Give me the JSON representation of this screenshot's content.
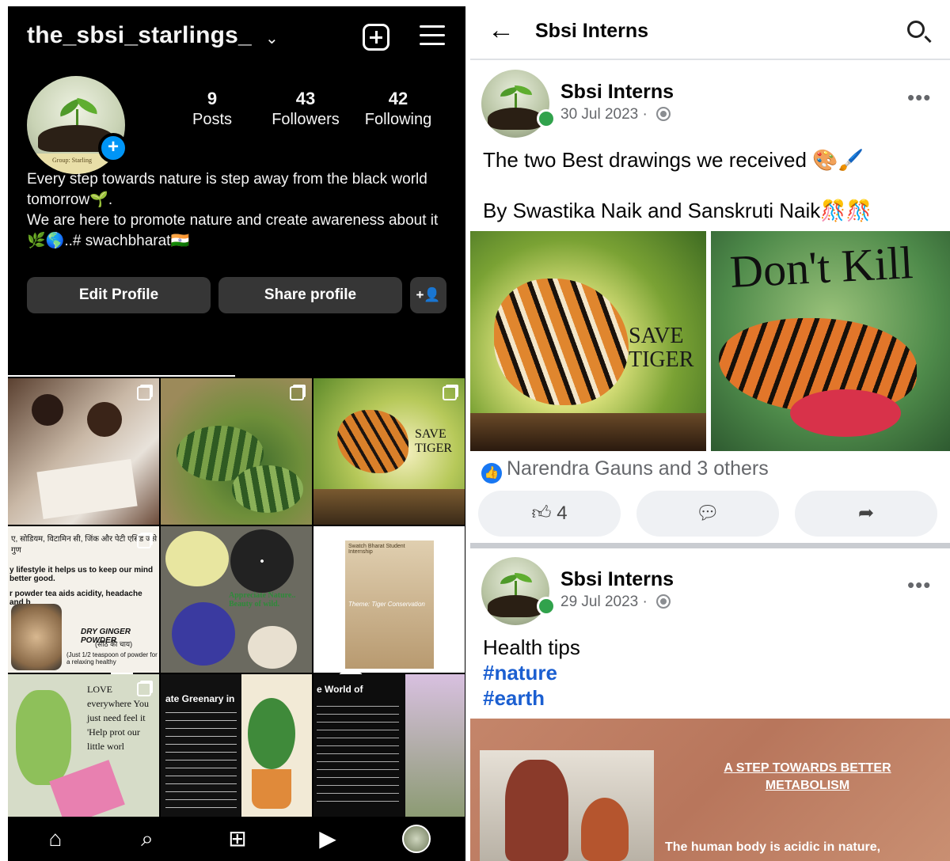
{
  "instagram": {
    "username": "the_sbsi_starlings_",
    "avatar_label": "Group: Starling",
    "stats": [
      {
        "num": "9",
        "label": "Posts"
      },
      {
        "num": "43",
        "label": "Followers"
      },
      {
        "num": "42",
        "label": "Following"
      }
    ],
    "bio": [
      "Every step towards nature is step away from the black world tomorrow🌱.",
      "We are here to promote nature and create awareness about it 🌿🌎..# swachbharat🇮🇳"
    ],
    "buttons": {
      "edit": "Edit Profile",
      "share": "Share profile",
      "add_person": "+👤"
    },
    "grid_texts": {
      "cell4_hindi": "ए, सोडियम, विटामिन सी, जिंक और पेटी एसिड जैसे गुण",
      "cell4_line1": "y lifestyle it helps us to keep our mind better good.",
      "cell4_line2": "r powder tea aids acidity, headache and b",
      "cell4_caption": "DRY GINGER POWDER",
      "cell4_sub": "(सौंठ की चाय)",
      "cell4_note": "(Just 1/2 teaspoon of powder for a relaxing healthy",
      "cell5_text": "Appreciate Nature.. Beauty of wild.",
      "cell6_title": "Swatch Bharat Student Internship",
      "cell6_theme": "Theme: Tiger Conservation",
      "cell7_text": "LOVE everywhere You just need feel it 'Help prot our little worl",
      "cell8_title": "ate Greenary in",
      "cell9_title": "e World of",
      "tiger_text": "SAVE TIGER"
    }
  },
  "facebook": {
    "title": "Sbsi Interns",
    "posts": [
      {
        "author": "Sbsi Interns",
        "date": "30 Jul 2023",
        "text_line1": "The two Best drawings we received 🎨🖌️",
        "text_line2": "By Swastika Naik and Sanskruti Naik🎊🎊",
        "image_left_text": "SAVE TIGER",
        "image_right_text": "Don't Kill",
        "reactions": "Narendra Gauns and 3 others",
        "like_count": "4"
      },
      {
        "author": "Sbsi Interns",
        "date": "29 Jul 2023",
        "text": "Health tips",
        "tags": [
          "#nature",
          "#earth"
        ],
        "banner_title": "A STEP TOWARDS BETTER METABOLISM",
        "banner_text": "The human body is acidic in nature,"
      }
    ]
  },
  "colors": {
    "ig_bg": "#000000",
    "ig_button": "#363636",
    "ig_accent": "#0095f6",
    "fb_link": "#1b5fd1",
    "fb_online": "#31a24c"
  }
}
